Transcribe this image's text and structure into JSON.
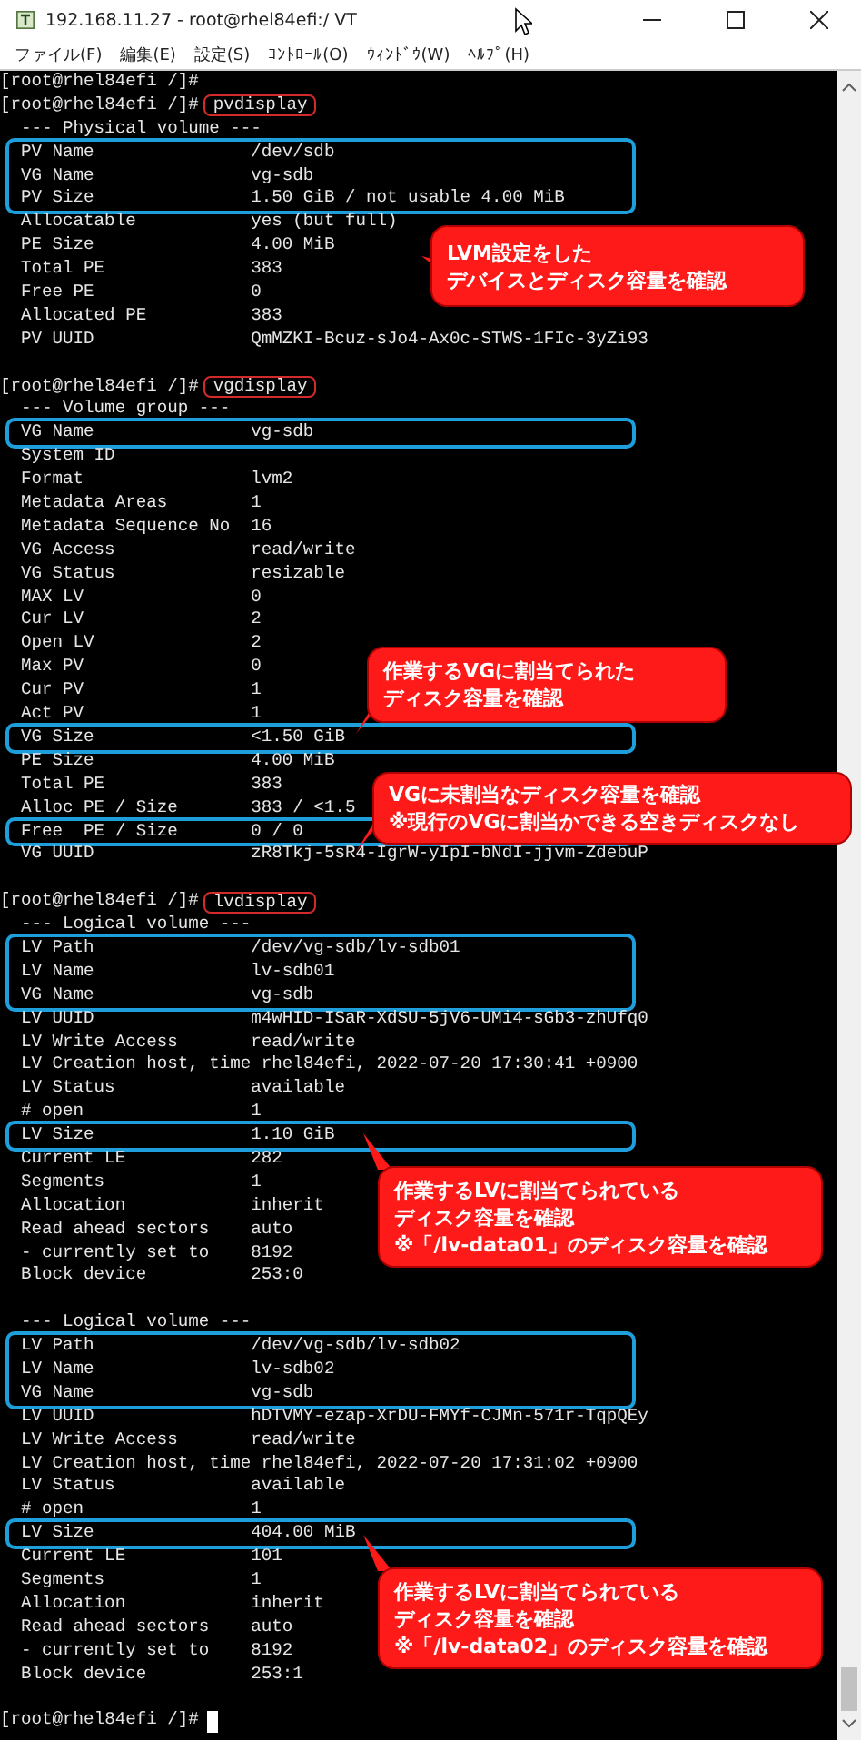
{
  "window": {
    "title": "192.168.11.27 - root@rhel84efi:/ VT"
  },
  "menu": [
    "ファイル(F)",
    "編集(E)",
    "設定(S)",
    "ｺﾝﾄﾛｰﾙ(O)",
    "ｳｨﾝﾄﾞｳ(W)",
    "ﾍﾙﾌﾟ(H)"
  ],
  "terminal": {
    "lines": [
      {
        "kind": "prompt",
        "prompt": "[root@rhel84efi /]#",
        "cursor": false,
        "boxed": false
      },
      {
        "kind": "prompt",
        "prompt": "[root@rhel84efi /]#",
        "command": "pvdisplay",
        "cursor": false,
        "boxed": false
      },
      {
        "kind": "header",
        "text": "--- Physical volume ---",
        "boxed": false
      },
      {
        "kind": "field",
        "label": "PV Name",
        "value": "/dev/sdb",
        "boxed": true
      },
      {
        "kind": "field",
        "label": "VG Name",
        "value": "vg-sdb",
        "boxed": true
      },
      {
        "kind": "field",
        "label": "PV Size",
        "value": "1.50 GiB / not usable 4.00 MiB",
        "boxed": true
      },
      {
        "kind": "field",
        "label": "Allocatable",
        "value": "yes (but full)",
        "boxed": false
      },
      {
        "kind": "field",
        "label": "PE Size",
        "value": "4.00 MiB",
        "boxed": false
      },
      {
        "kind": "field",
        "label": "Total PE",
        "value": "383",
        "boxed": false
      },
      {
        "kind": "field",
        "label": "Free PE",
        "value": "0",
        "boxed": false
      },
      {
        "kind": "field",
        "label": "Allocated PE",
        "value": "383",
        "boxed": false
      },
      {
        "kind": "field",
        "label": "PV UUID",
        "value": "QmMZKI-Bcuz-sJo4-Ax0c-STWS-1FIc-3yZi93",
        "boxed": false
      },
      {
        "kind": "blank",
        "boxed": false
      },
      {
        "kind": "prompt",
        "prompt": "[root@rhel84efi /]#",
        "command": "vgdisplay",
        "cursor": false,
        "boxed": false
      },
      {
        "kind": "header",
        "text": "--- Volume group ---",
        "boxed": false
      },
      {
        "kind": "field",
        "label": "VG Name",
        "value": "vg-sdb",
        "boxed": true
      },
      {
        "kind": "field",
        "label": "System ID",
        "boxed": false
      },
      {
        "kind": "field",
        "label": "Format",
        "value": "lvm2",
        "boxed": false
      },
      {
        "kind": "field",
        "label": "Metadata Areas",
        "value": "1",
        "boxed": false
      },
      {
        "kind": "field",
        "label": "Metadata Sequence No",
        "value": "16",
        "boxed": false
      },
      {
        "kind": "field",
        "label": "VG Access",
        "value": "read/write",
        "boxed": false
      },
      {
        "kind": "field",
        "label": "VG Status",
        "value": "resizable",
        "boxed": false
      },
      {
        "kind": "field",
        "label": "MAX LV",
        "value": "0",
        "boxed": false
      },
      {
        "kind": "field",
        "label": "Cur LV",
        "value": "2",
        "boxed": false
      },
      {
        "kind": "field",
        "label": "Open LV",
        "value": "2",
        "boxed": false
      },
      {
        "kind": "field",
        "label": "Max PV",
        "value": "0",
        "boxed": false
      },
      {
        "kind": "field",
        "label": "Cur PV",
        "value": "1",
        "boxed": false
      },
      {
        "kind": "field",
        "label": "Act PV",
        "value": "1",
        "boxed": false
      },
      {
        "kind": "field",
        "label": "VG Size",
        "value": "<1.50 GiB",
        "boxed": true
      },
      {
        "kind": "field",
        "label": "PE Size",
        "value": "4.00 MiB",
        "boxed": false
      },
      {
        "kind": "field",
        "label": "Total PE",
        "value": "383",
        "boxed": false
      },
      {
        "kind": "field",
        "label": "Alloc PE / Size",
        "value": "383 / <1.5",
        "boxed": false
      },
      {
        "kind": "field",
        "label": "Free  PE / Size",
        "value": "0 / 0",
        "boxed": true
      },
      {
        "kind": "field",
        "label": "VG UUID",
        "value": "zR8Tkj-5sR4-IgrW-yIpI-bNdI-jjvm-ZdebuP",
        "boxed": false
      },
      {
        "kind": "blank",
        "boxed": false
      },
      {
        "kind": "prompt",
        "prompt": "[root@rhel84efi /]#",
        "command": "lvdisplay",
        "cursor": false,
        "boxed": false
      },
      {
        "kind": "header",
        "text": "--- Logical volume ---",
        "boxed": false
      },
      {
        "kind": "field",
        "label": "LV Path",
        "value": "/dev/vg-sdb/lv-sdb01",
        "boxed": true
      },
      {
        "kind": "field",
        "label": "LV Name",
        "value": "lv-sdb01",
        "boxed": true
      },
      {
        "kind": "field",
        "label": "VG Name",
        "value": "vg-sdb",
        "boxed": true
      },
      {
        "kind": "field",
        "label": "LV UUID",
        "value": "m4wHID-ISaR-XdSU-5jV6-UMi4-sGb3-zhUfq0",
        "boxed": false
      },
      {
        "kind": "field",
        "label": "LV Write Access",
        "value": "read/write",
        "boxed": false
      },
      {
        "kind": "field",
        "label": "LV Creation host, time",
        "value": "rhel84efi, 2022-07-20 17:30:41 +0900",
        "boxed": false
      },
      {
        "kind": "field",
        "label": "LV Status",
        "value": "available",
        "boxed": false
      },
      {
        "kind": "field",
        "label": "# open",
        "value": "1",
        "boxed": false
      },
      {
        "kind": "field",
        "label": "LV Size",
        "value": "1.10 GiB",
        "boxed": true
      },
      {
        "kind": "field",
        "label": "Current LE",
        "value": "282",
        "boxed": false
      },
      {
        "kind": "field",
        "label": "Segments",
        "value": "1",
        "boxed": false
      },
      {
        "kind": "field",
        "label": "Allocation",
        "value": "inherit",
        "boxed": false
      },
      {
        "kind": "field",
        "label": "Read ahead sectors",
        "value": "auto",
        "boxed": false
      },
      {
        "kind": "field",
        "label": "- currently set to",
        "value": "8192",
        "boxed": false
      },
      {
        "kind": "field",
        "label": "Block device",
        "value": "253:0",
        "boxed": false
      },
      {
        "kind": "blank",
        "boxed": false
      },
      {
        "kind": "header",
        "text": "--- Logical volume ---",
        "boxed": false
      },
      {
        "kind": "field",
        "label": "LV Path",
        "value": "/dev/vg-sdb/lv-sdb02",
        "boxed": true
      },
      {
        "kind": "field",
        "label": "LV Name",
        "value": "lv-sdb02",
        "boxed": true
      },
      {
        "kind": "field",
        "label": "VG Name",
        "value": "vg-sdb",
        "boxed": true
      },
      {
        "kind": "field",
        "label": "LV UUID",
        "value": "hDTVMY-ezap-XrDU-FMYf-CJMn-571r-TqpQEy",
        "boxed": false
      },
      {
        "kind": "field",
        "label": "LV Write Access",
        "value": "read/write",
        "boxed": false
      },
      {
        "kind": "field",
        "label": "LV Creation host, time",
        "value": "rhel84efi, 2022-07-20 17:31:02 +0900",
        "boxed": false
      },
      {
        "kind": "field",
        "label": "LV Status",
        "value": "available",
        "boxed": false
      },
      {
        "kind": "field",
        "label": "# open",
        "value": "1",
        "boxed": false
      },
      {
        "kind": "field",
        "label": "LV Size",
        "value": "404.00 MiB",
        "boxed": true
      },
      {
        "kind": "field",
        "label": "Current LE",
        "value": "101",
        "boxed": false
      },
      {
        "kind": "field",
        "label": "Segments",
        "value": "1",
        "boxed": false
      },
      {
        "kind": "field",
        "label": "Allocation",
        "value": "inherit",
        "boxed": false
      },
      {
        "kind": "field",
        "label": "Read ahead sectors",
        "value": "auto",
        "boxed": false
      },
      {
        "kind": "field",
        "label": "- currently set to",
        "value": "8192",
        "boxed": false
      },
      {
        "kind": "field",
        "label": "Block device",
        "value": "253:1",
        "boxed": false
      },
      {
        "kind": "blank",
        "boxed": false
      },
      {
        "kind": "prompt",
        "prompt": "[root@rhel84efi /]#",
        "cursor": true,
        "boxed": false
      }
    ]
  },
  "callouts": [
    {
      "lines": [
        "LVM設定をした",
        "デバイスとディスク容量を確認"
      ]
    },
    {
      "lines": [
        "作業するVGに割当てられた",
        "ディスク容量を確認"
      ]
    },
    {
      "lines": [
        "VGに未割当なディスク容量を確認",
        "※現行のVGに割当かできる空きディスクなし"
      ]
    },
    {
      "lines": [
        "作業するLVに割当てられている",
        "ディスク容量を確認",
        "※「/lv-data01」のディスク容量を確認"
      ]
    },
    {
      "lines": [
        "作業するLVに割当てられている",
        "ディスク容量を確認",
        "※「/lv-data02」のディスク容量を確認"
      ]
    }
  ]
}
